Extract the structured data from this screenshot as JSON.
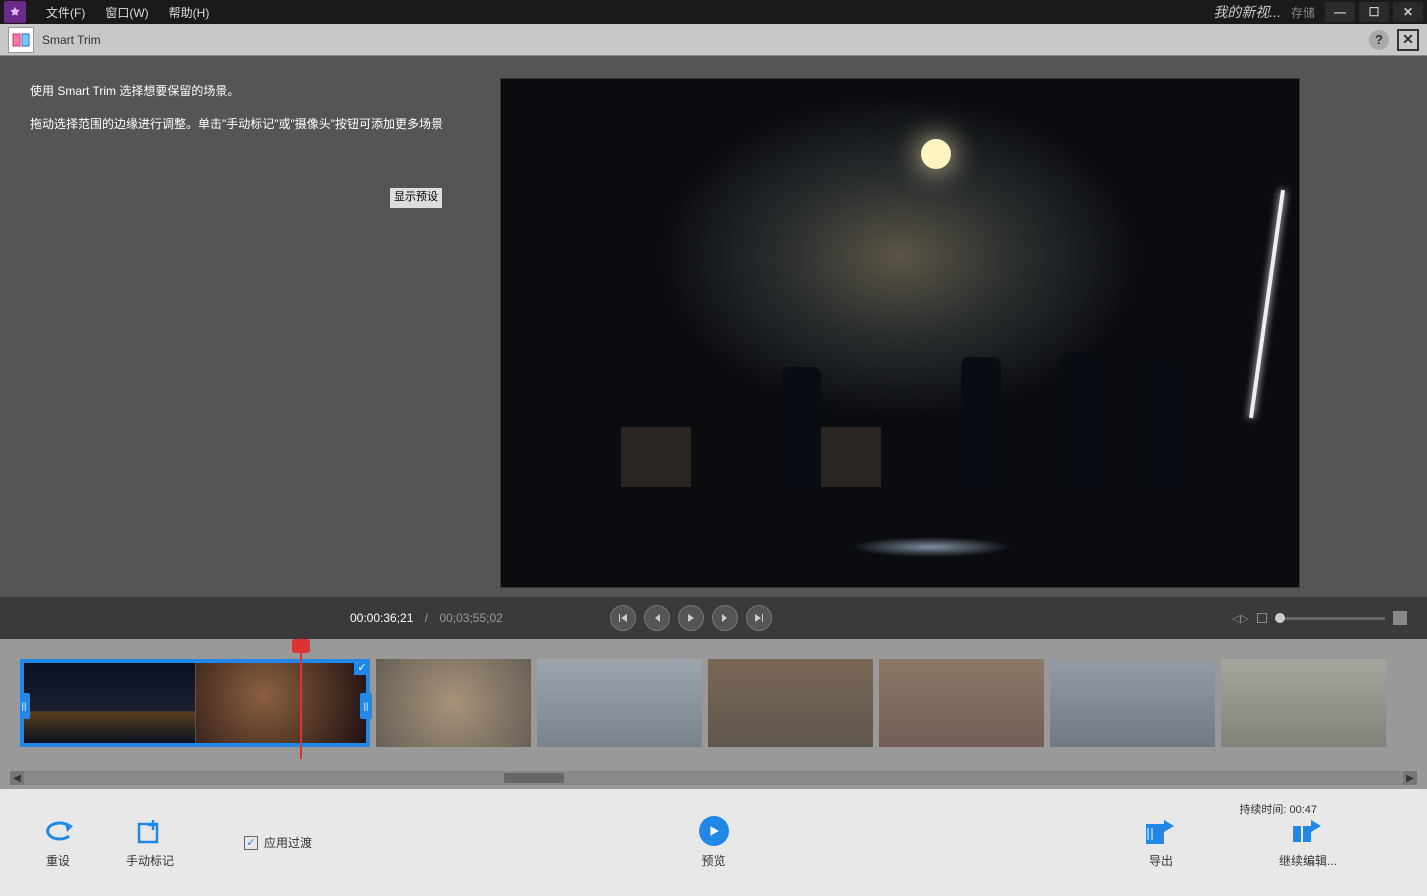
{
  "titlebar": {
    "project_name": "我的新视...",
    "save": "存储",
    "menus": {
      "file": "文件(F)",
      "window": "窗口(W)",
      "help": "帮助(H)"
    }
  },
  "panel": {
    "title": "Smart Trim",
    "help_line1": "使用 Smart Trim 选择想要保留的场景。",
    "help_line2": "拖动选择范围的边缘进行调整。单击\"手动标记\"或\"摄像头\"按钮可添加更多场景",
    "preset_button": "显示预设"
  },
  "controls": {
    "current_time": "00:00:36;21",
    "total_time": "00;03;55;02"
  },
  "footer": {
    "reset": "重设",
    "manual_mark": "手动标记",
    "apply_transition": "应用过渡",
    "preview": "预览",
    "duration_label": "持续时间: 00:47",
    "export": "导出",
    "continue_edit": "继续编辑..."
  }
}
